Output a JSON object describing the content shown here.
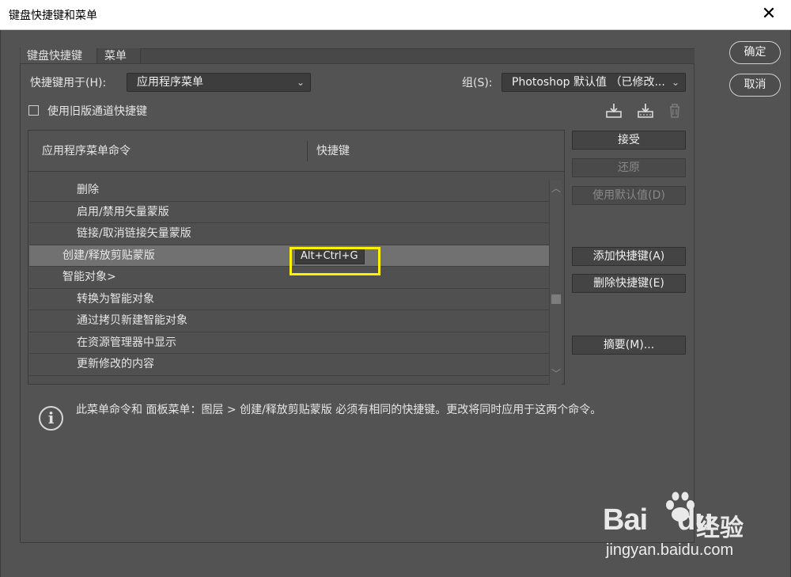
{
  "window": {
    "title": "键盘快捷键和菜单",
    "close_glyph": "✕"
  },
  "tabs": [
    {
      "label": "键盘快捷键"
    },
    {
      "label": "菜单"
    }
  ],
  "shortcuts_for": {
    "label": "快捷键用于(H):",
    "value": "应用程序菜单"
  },
  "set": {
    "label": "组(S):",
    "value": "Photoshop 默认值 （已修改..."
  },
  "legacy_channel": {
    "label": "使用旧版通道快捷键",
    "checked": false
  },
  "table": {
    "col_command": "应用程序菜单命令",
    "col_shortcut": "快捷键",
    "partial_row": "...",
    "rows": [
      {
        "command": "删除",
        "shortcut": "",
        "indent": 2
      },
      {
        "command": "启用/禁用矢量蒙版",
        "shortcut": "",
        "indent": 2
      },
      {
        "command": "链接/取消链接矢量蒙版",
        "shortcut": "",
        "indent": 2
      },
      {
        "command": "创建/释放剪贴蒙版",
        "shortcut": "Alt+Ctrl+G",
        "indent": 1,
        "selected": true
      },
      {
        "command": "智能对象>",
        "shortcut": "",
        "indent": 1
      },
      {
        "command": "转换为智能对象",
        "shortcut": "",
        "indent": 2
      },
      {
        "command": "通过拷贝新建智能对象",
        "shortcut": "",
        "indent": 2
      },
      {
        "command": "在资源管理器中显示",
        "shortcut": "",
        "indent": 2
      },
      {
        "command": "更新修改的内容",
        "shortcut": "",
        "indent": 2
      }
    ]
  },
  "buttons": {
    "ok": "确定",
    "cancel": "取消",
    "accept": "接受",
    "undo": "还原",
    "use_default": "使用默认值(D)",
    "add_shortcut": "添加快捷键(A)",
    "delete_shortcut": "删除快捷键(E)",
    "summarize": "摘要(M)..."
  },
  "info": {
    "icon": "i",
    "text": "此菜单命令和 面板菜单：图层 > 创建/释放剪贴蒙版 必须有相同的快捷键。更改将同时应用于这两个命令。"
  },
  "watermark": {
    "logo": "Bai",
    "logo2": "du",
    "cn": "经验",
    "url": "jingyan.baidu.com"
  },
  "colors": {
    "highlight": "#fff200",
    "selected_row": "#717171",
    "panel_bg": "#535353"
  }
}
